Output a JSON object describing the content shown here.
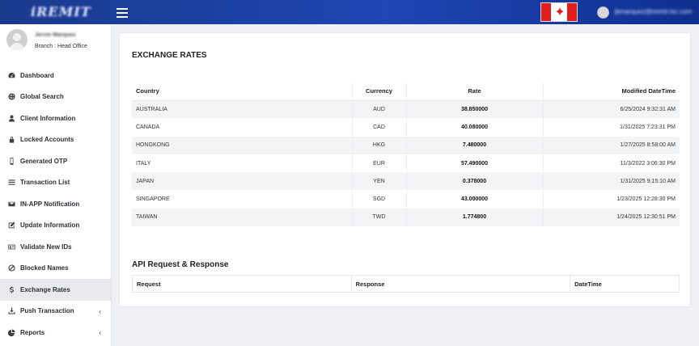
{
  "header": {
    "logo_text": "iREMIT",
    "user_email": "jbmarquez@iremit-inc.com",
    "flag": "canada-flag"
  },
  "profile": {
    "name": "Jervie Marquez",
    "branch": "Branch : Head Office"
  },
  "nav": [
    {
      "label": "Dashboard",
      "icon": "dashboard-icon"
    },
    {
      "label": "Global Search",
      "icon": "globe-icon"
    },
    {
      "label": "Client Information",
      "icon": "user-icon"
    },
    {
      "label": "Locked Accounts",
      "icon": "lock-icon"
    },
    {
      "label": "Generated OTP",
      "icon": "mobile-icon"
    },
    {
      "label": "Transaction List",
      "icon": "list-icon"
    },
    {
      "label": "IN-APP Notification",
      "icon": "envelope-icon"
    },
    {
      "label": "Update Information",
      "icon": "edit-icon"
    },
    {
      "label": "Validate New IDs",
      "icon": "id-card-icon"
    },
    {
      "label": "Blocked Names",
      "icon": "ban-icon"
    },
    {
      "label": "Exchange Rates",
      "icon": "dollar-icon",
      "active": true
    },
    {
      "label": "Push Transaction",
      "icon": "download-icon",
      "chevron": "‹"
    },
    {
      "label": "Reports",
      "icon": "pie-chart-icon",
      "chevron": "‹"
    }
  ],
  "exchange": {
    "title": "EXCHANGE RATES",
    "columns": [
      "Country",
      "Currency",
      "Rate",
      "Modified DateTime"
    ],
    "rows": [
      [
        "AUSTRALIA",
        "AUD",
        "38.850000",
        "6/25/2024 9:32:31 AM"
      ],
      [
        "CANADA",
        "CAD",
        "40.080000",
        "1/31/2025 7:23:31 PM"
      ],
      [
        "HONGKONG",
        "HKG",
        "7.480000",
        "1/27/2025 8:58:00 AM"
      ],
      [
        "ITALY",
        "EUR",
        "57.490000",
        "11/3/2022 3:06:30 PM"
      ],
      [
        "JAPAN",
        "YEN",
        "0.378000",
        "1/31/2025 9:15:10 AM"
      ],
      [
        "SINGAPORE",
        "SGD",
        "43.000000",
        "1/23/2025 12:28:30 PM"
      ],
      [
        "TAIWAN",
        "TWD",
        "1.774800",
        "1/24/2025 12:30:51 PM"
      ]
    ]
  },
  "api": {
    "title": "API Request & Response",
    "columns": [
      "Request",
      "Response",
      "DateTime"
    ]
  },
  "colors": {
    "header": "#1e46b4",
    "active_nav_bg": "#e8eaee"
  }
}
